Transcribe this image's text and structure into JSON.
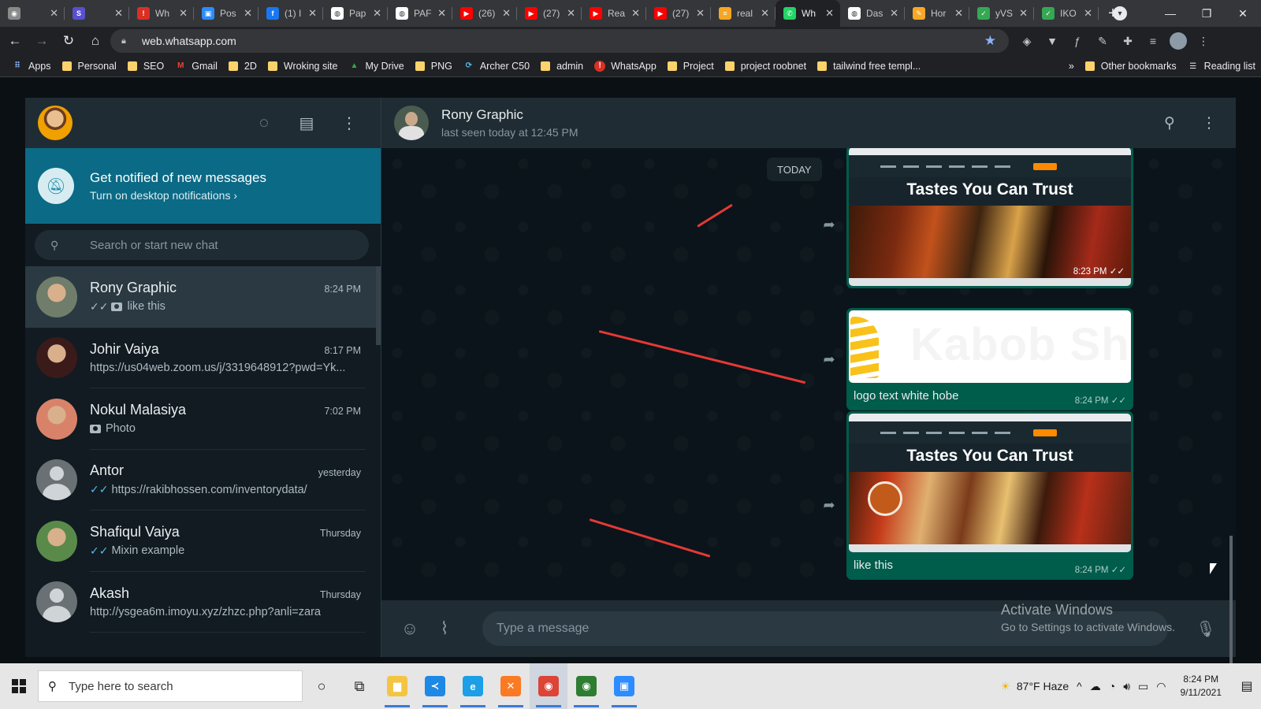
{
  "browser": {
    "tabs": [
      {
        "title": "",
        "color": "#8a8a8a",
        "glyph": "◉",
        "active": false
      },
      {
        "title": "",
        "color": "#5a4fcf",
        "glyph": "S",
        "active": false
      },
      {
        "title": "Wh",
        "color": "#d93025",
        "glyph": "!",
        "active": false
      },
      {
        "title": "Pos",
        "color": "#2d8cff",
        "glyph": "▣",
        "active": false
      },
      {
        "title": "(1) I",
        "color": "#1877f2",
        "glyph": "f",
        "active": false
      },
      {
        "title": "Pap",
        "color": "#ffffff",
        "glyph": "◍",
        "active": false
      },
      {
        "title": "PAF",
        "color": "#ffffff",
        "glyph": "◍",
        "active": false
      },
      {
        "title": "(26)",
        "color": "#ff0000",
        "glyph": "▶",
        "active": false
      },
      {
        "title": "(27)",
        "color": "#ff0000",
        "glyph": "▶",
        "active": false
      },
      {
        "title": "Rea",
        "color": "#ff0000",
        "glyph": "▶",
        "active": false
      },
      {
        "title": "(27)",
        "color": "#ff0000",
        "glyph": "▶",
        "active": false
      },
      {
        "title": "real",
        "color": "#f5a623",
        "glyph": "≡",
        "active": false
      },
      {
        "title": "Wh",
        "color": "#25d366",
        "glyph": "✆",
        "active": true
      },
      {
        "title": "Das",
        "color": "#ffffff",
        "glyph": "◍",
        "active": false
      },
      {
        "title": "Hor",
        "color": "#f9a825",
        "glyph": "✎",
        "active": false
      },
      {
        "title": "yVS",
        "color": "#34a853",
        "glyph": "✓",
        "active": false
      },
      {
        "title": "IKO",
        "color": "#34a853",
        "glyph": "✓",
        "active": false
      }
    ],
    "url": "web.whatsapp.com",
    "bookmarks": [
      {
        "label": "Apps",
        "type": "apps"
      },
      {
        "label": "Personal",
        "type": "folder"
      },
      {
        "label": "SEO",
        "type": "folder"
      },
      {
        "label": "Gmail",
        "type": "gmail"
      },
      {
        "label": "2D",
        "type": "folder"
      },
      {
        "label": "Wroking site",
        "type": "folder"
      },
      {
        "label": "My Drive",
        "type": "drive"
      },
      {
        "label": "PNG",
        "type": "folder"
      },
      {
        "label": "Archer C50",
        "type": "tplink"
      },
      {
        "label": "admin",
        "type": "folder"
      },
      {
        "label": "WhatsApp",
        "type": "alert"
      },
      {
        "label": "Project",
        "type": "folder"
      },
      {
        "label": "project roobnet",
        "type": "folder"
      },
      {
        "label": "tailwind free templ...",
        "type": "folder"
      }
    ],
    "bookmarks_overflow": "»",
    "other_bookmarks": "Other bookmarks",
    "reading_list": "Reading list"
  },
  "whatsapp": {
    "notification": {
      "title": "Get notified of new messages",
      "link": "Turn on desktop notifications ›"
    },
    "search_placeholder": "Search or start new chat",
    "chats": [
      {
        "name": "Rony Graphic",
        "time": "8:24 PM",
        "tick": "grey",
        "photo": true,
        "preview": "like this",
        "avatar_color": "#6f7d6a",
        "active": true
      },
      {
        "name": "Johir Vaiya",
        "time": "8:17 PM",
        "tick": "none",
        "photo": false,
        "preview": "https://us04web.zoom.us/j/3319648912?pwd=Yk...",
        "avatar_color": "#3b1a1a",
        "active": false
      },
      {
        "name": "Nokul Malasiya",
        "time": "7:02 PM",
        "tick": "none",
        "photo": true,
        "preview": "Photo",
        "avatar_color": "#d9826a",
        "active": false
      },
      {
        "name": "Antor",
        "time": "yesterday",
        "tick": "blue",
        "photo": false,
        "preview": "https://rakibhossen.com/inventorydata/",
        "avatar_color": "default",
        "active": false
      },
      {
        "name": "Shafiqul Vaiya",
        "time": "Thursday",
        "tick": "blue",
        "photo": false,
        "preview": "Mixin example",
        "avatar_color": "#5a8a4a",
        "active": false
      },
      {
        "name": "Akash",
        "time": "Thursday",
        "tick": "none",
        "photo": false,
        "preview": "http://ysgea6m.imoyu.xyz/zhzc.php?anli=zara",
        "avatar_color": "default",
        "active": false
      }
    ],
    "conversation": {
      "name": "Rony Graphic",
      "status": "last seen today at 12:45 PM",
      "date_chip": "TODAY",
      "messages": [
        {
          "type": "screenshot",
          "headline": "Tastes You Can Trust",
          "time": "8:23 PM"
        },
        {
          "type": "logo",
          "logo_text": "Kabob Shac",
          "caption": "logo text white hobe",
          "time": "8:24 PM"
        },
        {
          "type": "screenshot",
          "headline": "Tastes You Can Trust",
          "caption": "like this",
          "time": "8:24 PM"
        }
      ],
      "composer_placeholder": "Type a message"
    },
    "watermark": {
      "line1": "Activate Windows",
      "line2": "Go to Settings to activate Windows."
    }
  },
  "taskbar": {
    "search_placeholder": "Type here to search",
    "weather": "87°F  Haze",
    "time": "8:24 PM",
    "date": "9/11/2021",
    "apps": [
      {
        "name": "explorer",
        "color": "#f4c542",
        "glyph": "▆"
      },
      {
        "name": "vscode",
        "color": "#1e88e5",
        "glyph": "≺"
      },
      {
        "name": "edge",
        "color": "#1c9fe6",
        "glyph": "e"
      },
      {
        "name": "xampp",
        "color": "#fb7a24",
        "glyph": "✕"
      },
      {
        "name": "chrome",
        "color": "#db4437",
        "glyph": "◉"
      },
      {
        "name": "chrome-dev",
        "color": "#2e7d32",
        "glyph": "◉"
      },
      {
        "name": "zoom",
        "color": "#2d8cff",
        "glyph": "▣"
      }
    ]
  }
}
